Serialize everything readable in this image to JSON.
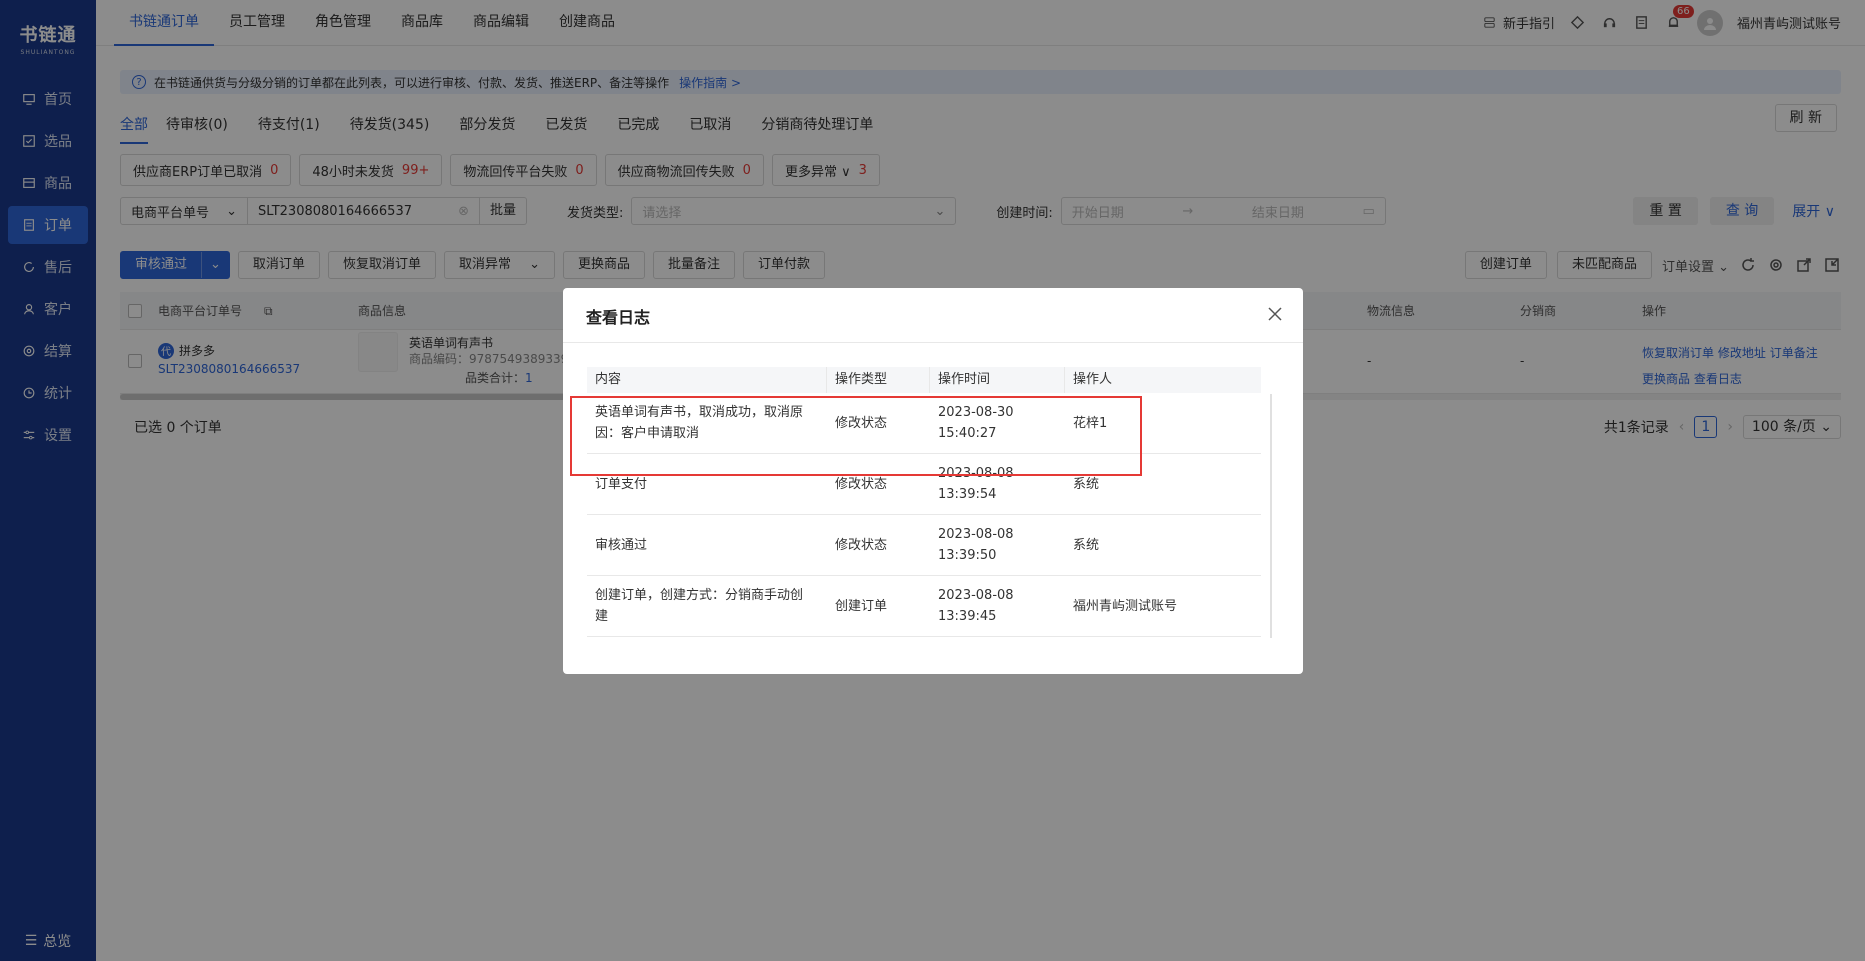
{
  "sidebar": {
    "logo_main": "书链通",
    "logo_sub": "SHULIANTONG",
    "items": [
      {
        "label": "首页",
        "icon": "monitor-icon"
      },
      {
        "label": "选品",
        "icon": "checklist-icon"
      },
      {
        "label": "商品",
        "icon": "box-icon"
      },
      {
        "label": "订单",
        "icon": "order-icon"
      },
      {
        "label": "售后",
        "icon": "refresh-icon"
      },
      {
        "label": "客户",
        "icon": "user-icon"
      },
      {
        "label": "结算",
        "icon": "settle-icon"
      },
      {
        "label": "统计",
        "icon": "clock-icon"
      },
      {
        "label": "设置",
        "icon": "sliders-icon"
      }
    ],
    "active_index": 3,
    "overview": "总览"
  },
  "topbar": {
    "tabs": [
      "书链通订单",
      "员工管理",
      "角色管理",
      "商品库",
      "商品编辑",
      "创建商品"
    ],
    "active_tab": 0,
    "guide": "新手指引",
    "notif_count": "66",
    "account": "福州青屿测试账号"
  },
  "notice": {
    "text": "在书链通供货与分级分销的订单都在此列表，可以进行审核、付款、发货、推送ERP、备注等操作",
    "link": "操作指南 >"
  },
  "status_tabs": [
    "全部",
    "待审核(0)",
    "待支付(1)",
    "待发货(345)",
    "部分发货",
    "已发货",
    "已完成",
    "已取消",
    "分销商待处理订单"
  ],
  "refresh_label": "刷 新",
  "chips": [
    {
      "label": "供应商ERP订单已取消",
      "count": "0"
    },
    {
      "label": "48小时未发货",
      "count": "99+"
    },
    {
      "label": "物流回传平台失败",
      "count": "0"
    },
    {
      "label": "供应商物流回传失败",
      "count": "0"
    },
    {
      "label": "更多异常 ∨",
      "count": "3"
    }
  ],
  "filter": {
    "field_select": "电商平台单号",
    "order_no": "SLT2308080164666537",
    "batch": "批量",
    "ship_type_label": "发货类型:",
    "ship_type_placeholder": "请选择",
    "create_time_label": "创建时间:",
    "start_placeholder": "开始日期",
    "end_placeholder": "结束日期",
    "reset": "重 置",
    "query": "查 询",
    "expand": "展开"
  },
  "actions": {
    "approve": "审核通过",
    "cancel": "取消订单",
    "restore": "恢复取消订单",
    "cancel_exception": "取消异常",
    "replace": "更换商品",
    "batch_note": "批量备注",
    "pay": "订单付款",
    "create": "创建订单",
    "unmatched": "未匹配商品",
    "settings": "订单设置"
  },
  "table": {
    "headers": [
      "电商平台订单号",
      "商品信息",
      "物流信息",
      "分销商",
      "操作"
    ],
    "row": {
      "platform_badge": "代",
      "platform": "拼多多",
      "order_no": "SLT2308080164666537",
      "product_name": "英语单词有声书",
      "product_code": "商品编码：9787549389339",
      "qty_label": "品类合计：",
      "qty": "1",
      "logistics": "-",
      "distributor": "-",
      "ops": [
        "恢复取消订单",
        "修改地址",
        "订单备注",
        "更换商品",
        "查看日志"
      ]
    }
  },
  "footer": {
    "selected": "已选  0  个订单",
    "total": "共1条记录",
    "page": "1",
    "page_size": "100 条/页"
  },
  "modal": {
    "title": "查看日志",
    "headers": [
      "内容",
      "操作类型",
      "操作时间",
      "操作人"
    ],
    "rows": [
      {
        "content": "英语单词有声书，取消成功，取消原因：客户申请取消",
        "type": "修改状态",
        "date": "2023-08-30",
        "time": "15:40:27",
        "operator": "花梓1"
      },
      {
        "content": "订单支付",
        "type": "修改状态",
        "date": "2023-08-08",
        "time": "13:39:54",
        "operator": "系统"
      },
      {
        "content": "审核通过",
        "type": "修改状态",
        "date": "2023-08-08",
        "time": "13:39:50",
        "operator": "系统"
      },
      {
        "content": "创建订单，创建方式：分销商手动创建",
        "type": "创建订单",
        "date": "2023-08-08",
        "time": "13:39:45",
        "operator": "福州青屿测试账号"
      }
    ]
  },
  "colors": {
    "sidebar": "#1b3a8c",
    "accent": "#2f66d9",
    "danger": "#e53935"
  }
}
